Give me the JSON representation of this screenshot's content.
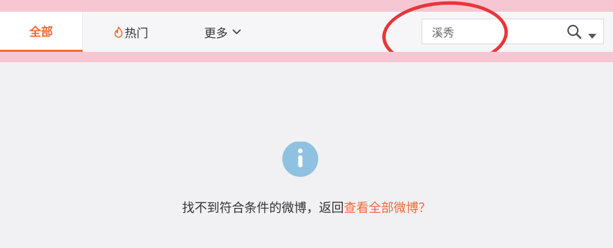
{
  "tabs": {
    "all": "全部",
    "hot": "热门",
    "more": "更多"
  },
  "search": {
    "value": "溪秀",
    "placeholder": ""
  },
  "icons": {
    "hot": "flame-icon",
    "more": "chevron-down-icon",
    "search": "search-icon",
    "search_options": "caret-down-icon",
    "empty_state": "info-icon"
  },
  "empty_state": {
    "message": "找不到符合条件的微博，返回",
    "link": "查看全部微博？"
  },
  "colors": {
    "accent": "#f26a36",
    "pink_band": "#f6c7d2",
    "info_icon": "#8ec2e0",
    "annotation": "#e8363a"
  }
}
